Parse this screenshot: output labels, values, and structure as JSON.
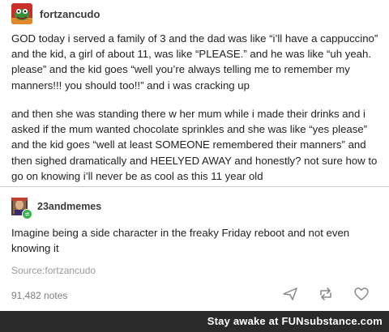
{
  "post": {
    "username": "fortzancudo",
    "paragraph_1": "GOD today i served a family of 3 and the dad was like “i’ll have a cappuccino” and the kid, a girl of about 11, was like “PLEASE.” and he was like “uh yeah. please” and the kid goes “well you’re always telling me to remember my manners!!! you should too!!” and i was cracking up",
    "paragraph_2": "and then she was standing there w her mum while i made their drinks and i asked if the mum wanted chocolate sprinkles and she was like “yes please” and the kid goes “well at least SOMEONE remembered their manners” and then sighed dramatically and HEELYED AWAY and honestly? not sure how to go on knowing i’ll never be as cool as this 11 year old"
  },
  "reblog": {
    "username": "23andmemes",
    "text": "Imagine being a side character in the freaky Friday reboot and not even knowing it"
  },
  "source_label": "Source:fortzancudo",
  "notes_count": "91,482 notes",
  "icons": {
    "share": "share-icon",
    "reblog": "reblog-icon",
    "like": "heart-icon"
  },
  "footer": {
    "prefix": "Stay awake at ",
    "brand": "FUNsubstance.com"
  },
  "colors": {
    "text": "#222222",
    "muted": "#9a9a9a",
    "footer_bg": "#2a2a2a",
    "badge_green": "#37b34a"
  }
}
